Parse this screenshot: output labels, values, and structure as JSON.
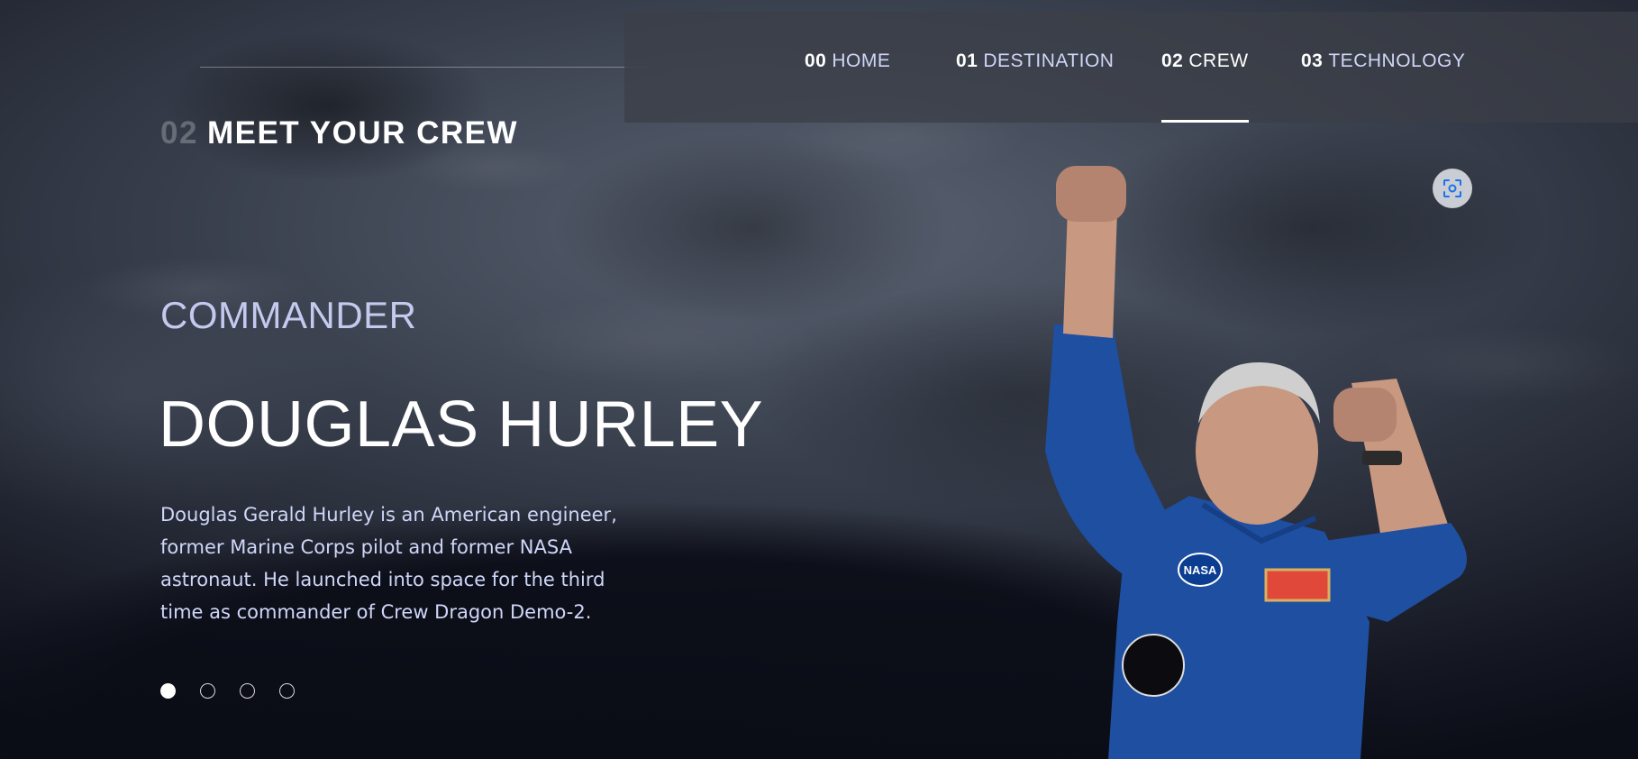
{
  "nav": {
    "items": [
      {
        "num": "00",
        "label": "HOME"
      },
      {
        "num": "01",
        "label": "DESTINATION"
      },
      {
        "num": "02",
        "label": "CREW"
      },
      {
        "num": "03",
        "label": "TECHNOLOGY"
      }
    ],
    "active_index": 2
  },
  "heading": {
    "num": "02",
    "text": "MEET YOUR CREW"
  },
  "crew": {
    "role": "COMMANDER",
    "name": "DOUGLAS HURLEY",
    "bio": "Douglas Gerald Hurley is an American engineer, former Marine Corps pilot and former NASA astronaut. He launched into space for the third time as commander of Crew Dragon Demo-2.",
    "patch_label": "NASA"
  },
  "pagination": {
    "count": 4,
    "active_index": 0
  },
  "icons": {
    "lens": "visual-search-icon"
  },
  "colors": {
    "background": "#0b0d17",
    "accent_text": "#d0d6f9",
    "suit_blue": "#1f4fa0"
  }
}
